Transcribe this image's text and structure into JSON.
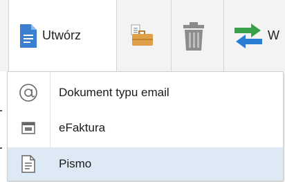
{
  "toolbar": {
    "create_button": {
      "label": "Utwórz",
      "icon": "document-icon"
    },
    "briefcase_button": {
      "icon": "briefcase-icon"
    },
    "delete_button": {
      "icon": "trash-icon"
    },
    "transfer_button": {
      "label": "W",
      "icon": "arrows-exchange-icon"
    }
  },
  "dropdown": {
    "items": [
      {
        "label": "Dokument typu email",
        "icon": "at-sign-icon"
      },
      {
        "label": "eFaktura",
        "icon": "invoice-icon"
      },
      {
        "label": "Pismo",
        "icon": "letter-document-icon",
        "highlighted": true
      }
    ]
  },
  "colors": {
    "toolbar_bg": "#f3f3f3",
    "doc_blue": "#3a7fd0",
    "highlight_bg": "#dde9f5",
    "arrow_green": "#3aa04a",
    "arrow_blue": "#2b7cd3",
    "trash_gray": "#8c8c8c",
    "briefcase_orange": "#e0a04a"
  }
}
